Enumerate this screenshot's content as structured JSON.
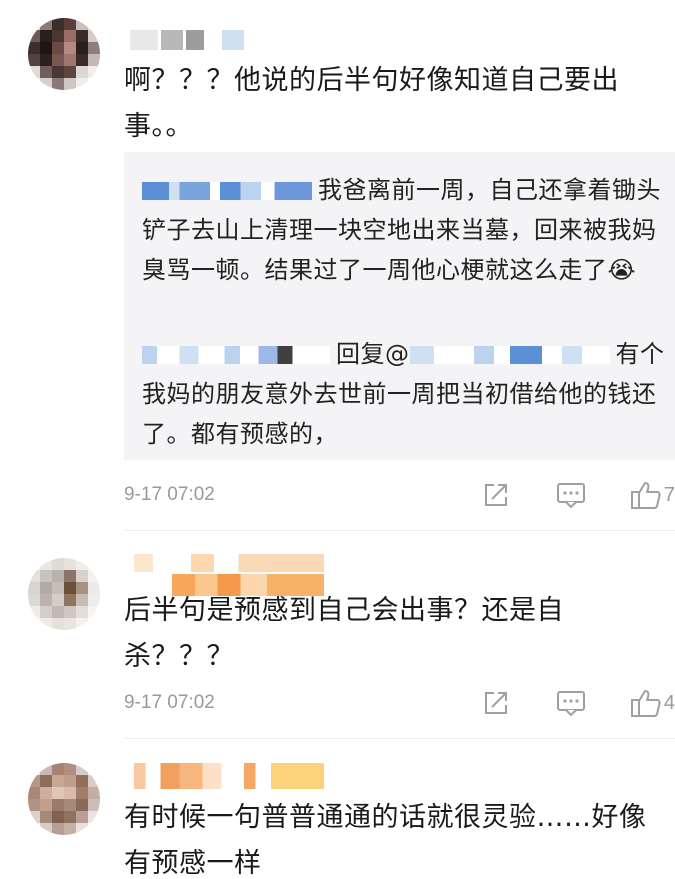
{
  "comments": [
    {
      "text": "啊？？？他说的后半句好像知道自己要出事。。",
      "replies": [
        {
          "text": "我爸离前一周，自己还拿着锄头铲子去山上清理一块空地出来当墓，回来被我妈臭骂一顿。结果过了一周他心梗就这么走了😭"
        },
        {
          "prefix": "回复@",
          "text": "有个我妈的朋友意外去世前一周把当初借给他的钱还了。都有预感的，"
        }
      ],
      "time": "9-17 07:02",
      "likes": "7",
      "icons": {
        "share": "share-icon",
        "comment": "comment-icon",
        "like": "thumbs-up-icon"
      }
    },
    {
      "text": "后半句是预感到自己会出事？还是自杀？？？",
      "time": "9-17 07:02",
      "likes": "4",
      "icons": {
        "share": "share-icon",
        "comment": "comment-icon",
        "like": "thumbs-up-icon"
      }
    },
    {
      "text": "有时候一句普普通通的话就很灵验……好像有预感一样"
    }
  ],
  "colors": {
    "meta_gray": "#9a9a9a",
    "reply_bg": "#f4f4f6",
    "blur_blue": "#5b8fd6",
    "blur_orange": "#f4a340"
  }
}
